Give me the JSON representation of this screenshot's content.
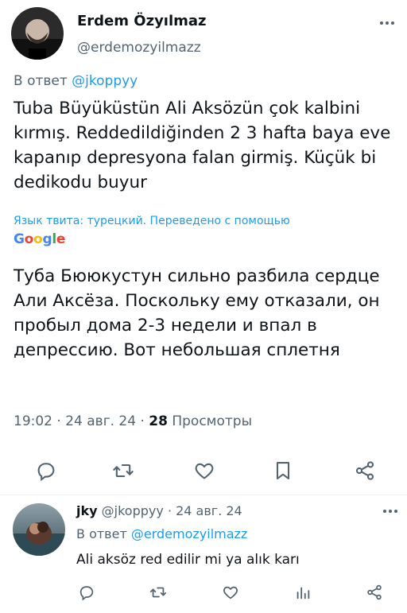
{
  "tweet": {
    "author_name": "Erdem Özyılmaz",
    "author_handle": "@erdemozyilmazz",
    "reply_prefix": "В ответ",
    "reply_to": "@jkoppyy",
    "text": "Tuba Büyüküstün Ali Aksözün çok kalbini kırmış. Reddedildiğinden 2 3 hafta baya eve kapanıp depresyona falan girmiş. Küçük bi dedikodu buyur",
    "translate_note": "Язык твита: турецкий. Переведено с помощью",
    "translate_provider": "Google",
    "translated_text": "Туба Бююкустун сильно разбила сердце Али Аксёза. Поскольку ему отказали, он пробыл дома 2-3 недели и впал в депрессию. Вот небольшая сплетня",
    "time": "19:02",
    "date": "24 авг. 24",
    "views_count": "28",
    "views_label": "Просмотры",
    "actions": [
      "reply-icon",
      "retweet-icon",
      "like-icon",
      "bookmark-icon",
      "share-icon"
    ]
  },
  "reply": {
    "author_name": "jky",
    "author_handle": "@jkoppyy",
    "date": "24 авг. 24",
    "reply_prefix": "В ответ",
    "reply_to": "@erdemozyilmazz",
    "text": "Ali aksöz red edilir mi ya alık karı",
    "actions": [
      "reply-icon",
      "retweet-icon",
      "like-icon",
      "views-icon",
      "share-icon"
    ]
  },
  "colors": {
    "accent": "#1d9bf0",
    "secondary_text": "#536471",
    "primary_text": "#0f1419"
  }
}
